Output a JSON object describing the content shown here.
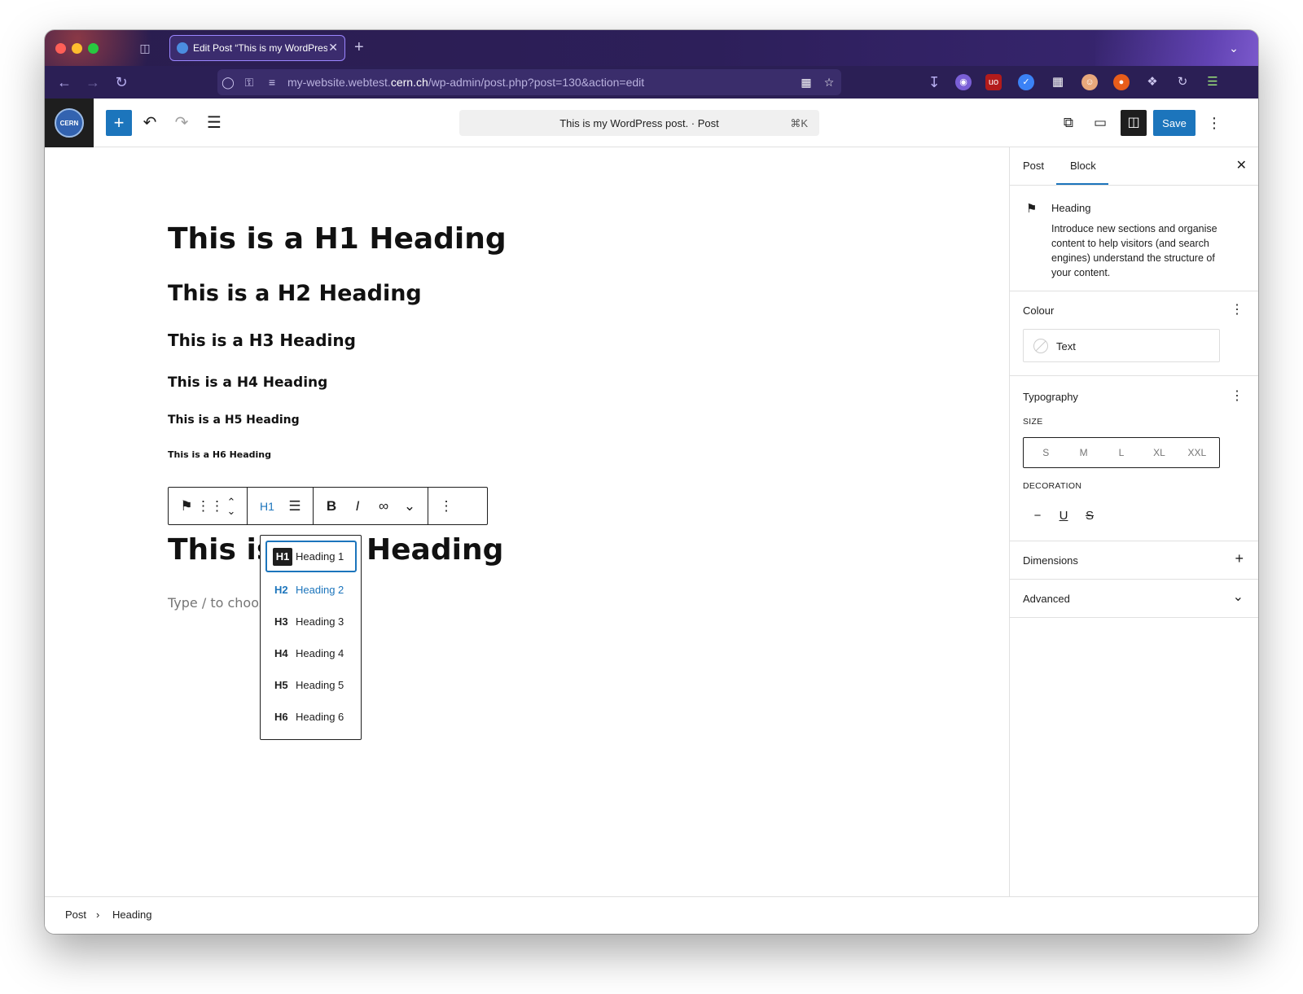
{
  "browser": {
    "tab_title": "Edit Post “This is my WordPress post.” ‹ my website — WordPress",
    "tab_close": "✕",
    "new_tab": "+",
    "url_prefix": "my-website.webtest.",
    "url_host": "cern.ch",
    "url_path": "/wp-admin/post.php?post=130&action=edit"
  },
  "header": {
    "site_logo_text": "CERN",
    "command_title": "This is my WordPress post. · Post",
    "command_shortcut": "⌘K",
    "save_label": "Save"
  },
  "content": {
    "h1": "This is a H1 Heading",
    "h2": "This is a H2 Heading",
    "h3": "This is a H3 Heading",
    "h4": "This is a H4 Heading",
    "h5": "This is a H5 Heading",
    "h6": "This is a H6 Heading",
    "selected_heading_start": "This is",
    "selected_heading_end": "Heading",
    "placeholder": "Type / to choos"
  },
  "block_toolbar": {
    "level_label": "H1",
    "bold": "B",
    "italic": "I"
  },
  "heading_menu": {
    "items": [
      {
        "level": "H1",
        "label": "Heading 1"
      },
      {
        "level": "H2",
        "label": "Heading 2"
      },
      {
        "level": "H3",
        "label": "Heading 3"
      },
      {
        "level": "H4",
        "label": "Heading 4"
      },
      {
        "level": "H5",
        "label": "Heading 5"
      },
      {
        "level": "H6",
        "label": "Heading 6"
      }
    ]
  },
  "sidebar": {
    "tab_post": "Post",
    "tab_block": "Block",
    "block_title": "Heading",
    "block_description": "Introduce new sections and organise content to help visitors (and search engines) understand the structure of your content.",
    "colour": {
      "title": "Colour",
      "item": "Text"
    },
    "typography": {
      "title": "Typography",
      "size_label": "SIZE",
      "sizes": [
        "S",
        "M",
        "L",
        "XL",
        "XXL"
      ],
      "decoration_label": "DECORATION",
      "decorations": [
        "−",
        "U",
        "S"
      ]
    },
    "dimensions": "Dimensions",
    "advanced": "Advanced"
  },
  "footer": {
    "breadcrumb_root": "Post",
    "breadcrumb_sep": "›",
    "breadcrumb_current": "Heading"
  },
  "colors": {
    "accent": "#1c75bc",
    "browser_bg": "#2b1f55"
  }
}
